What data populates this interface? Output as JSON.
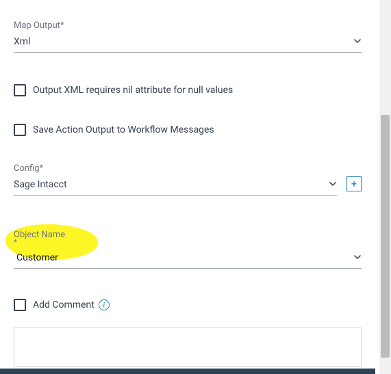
{
  "mapOutput": {
    "label": "Map Output*",
    "value": "Xml"
  },
  "checkboxes": {
    "nilAttribute": "Output XML requires nil attribute for null values",
    "saveAction": "Save Action Output to Workflow Messages",
    "addComment": "Add Comment"
  },
  "config": {
    "label": "Config*",
    "value": "Sage Intacct"
  },
  "objectName": {
    "label": "Object Name",
    "asterisk": "*",
    "value": "Customer"
  },
  "icons": {
    "plus": "+",
    "info": "i"
  }
}
